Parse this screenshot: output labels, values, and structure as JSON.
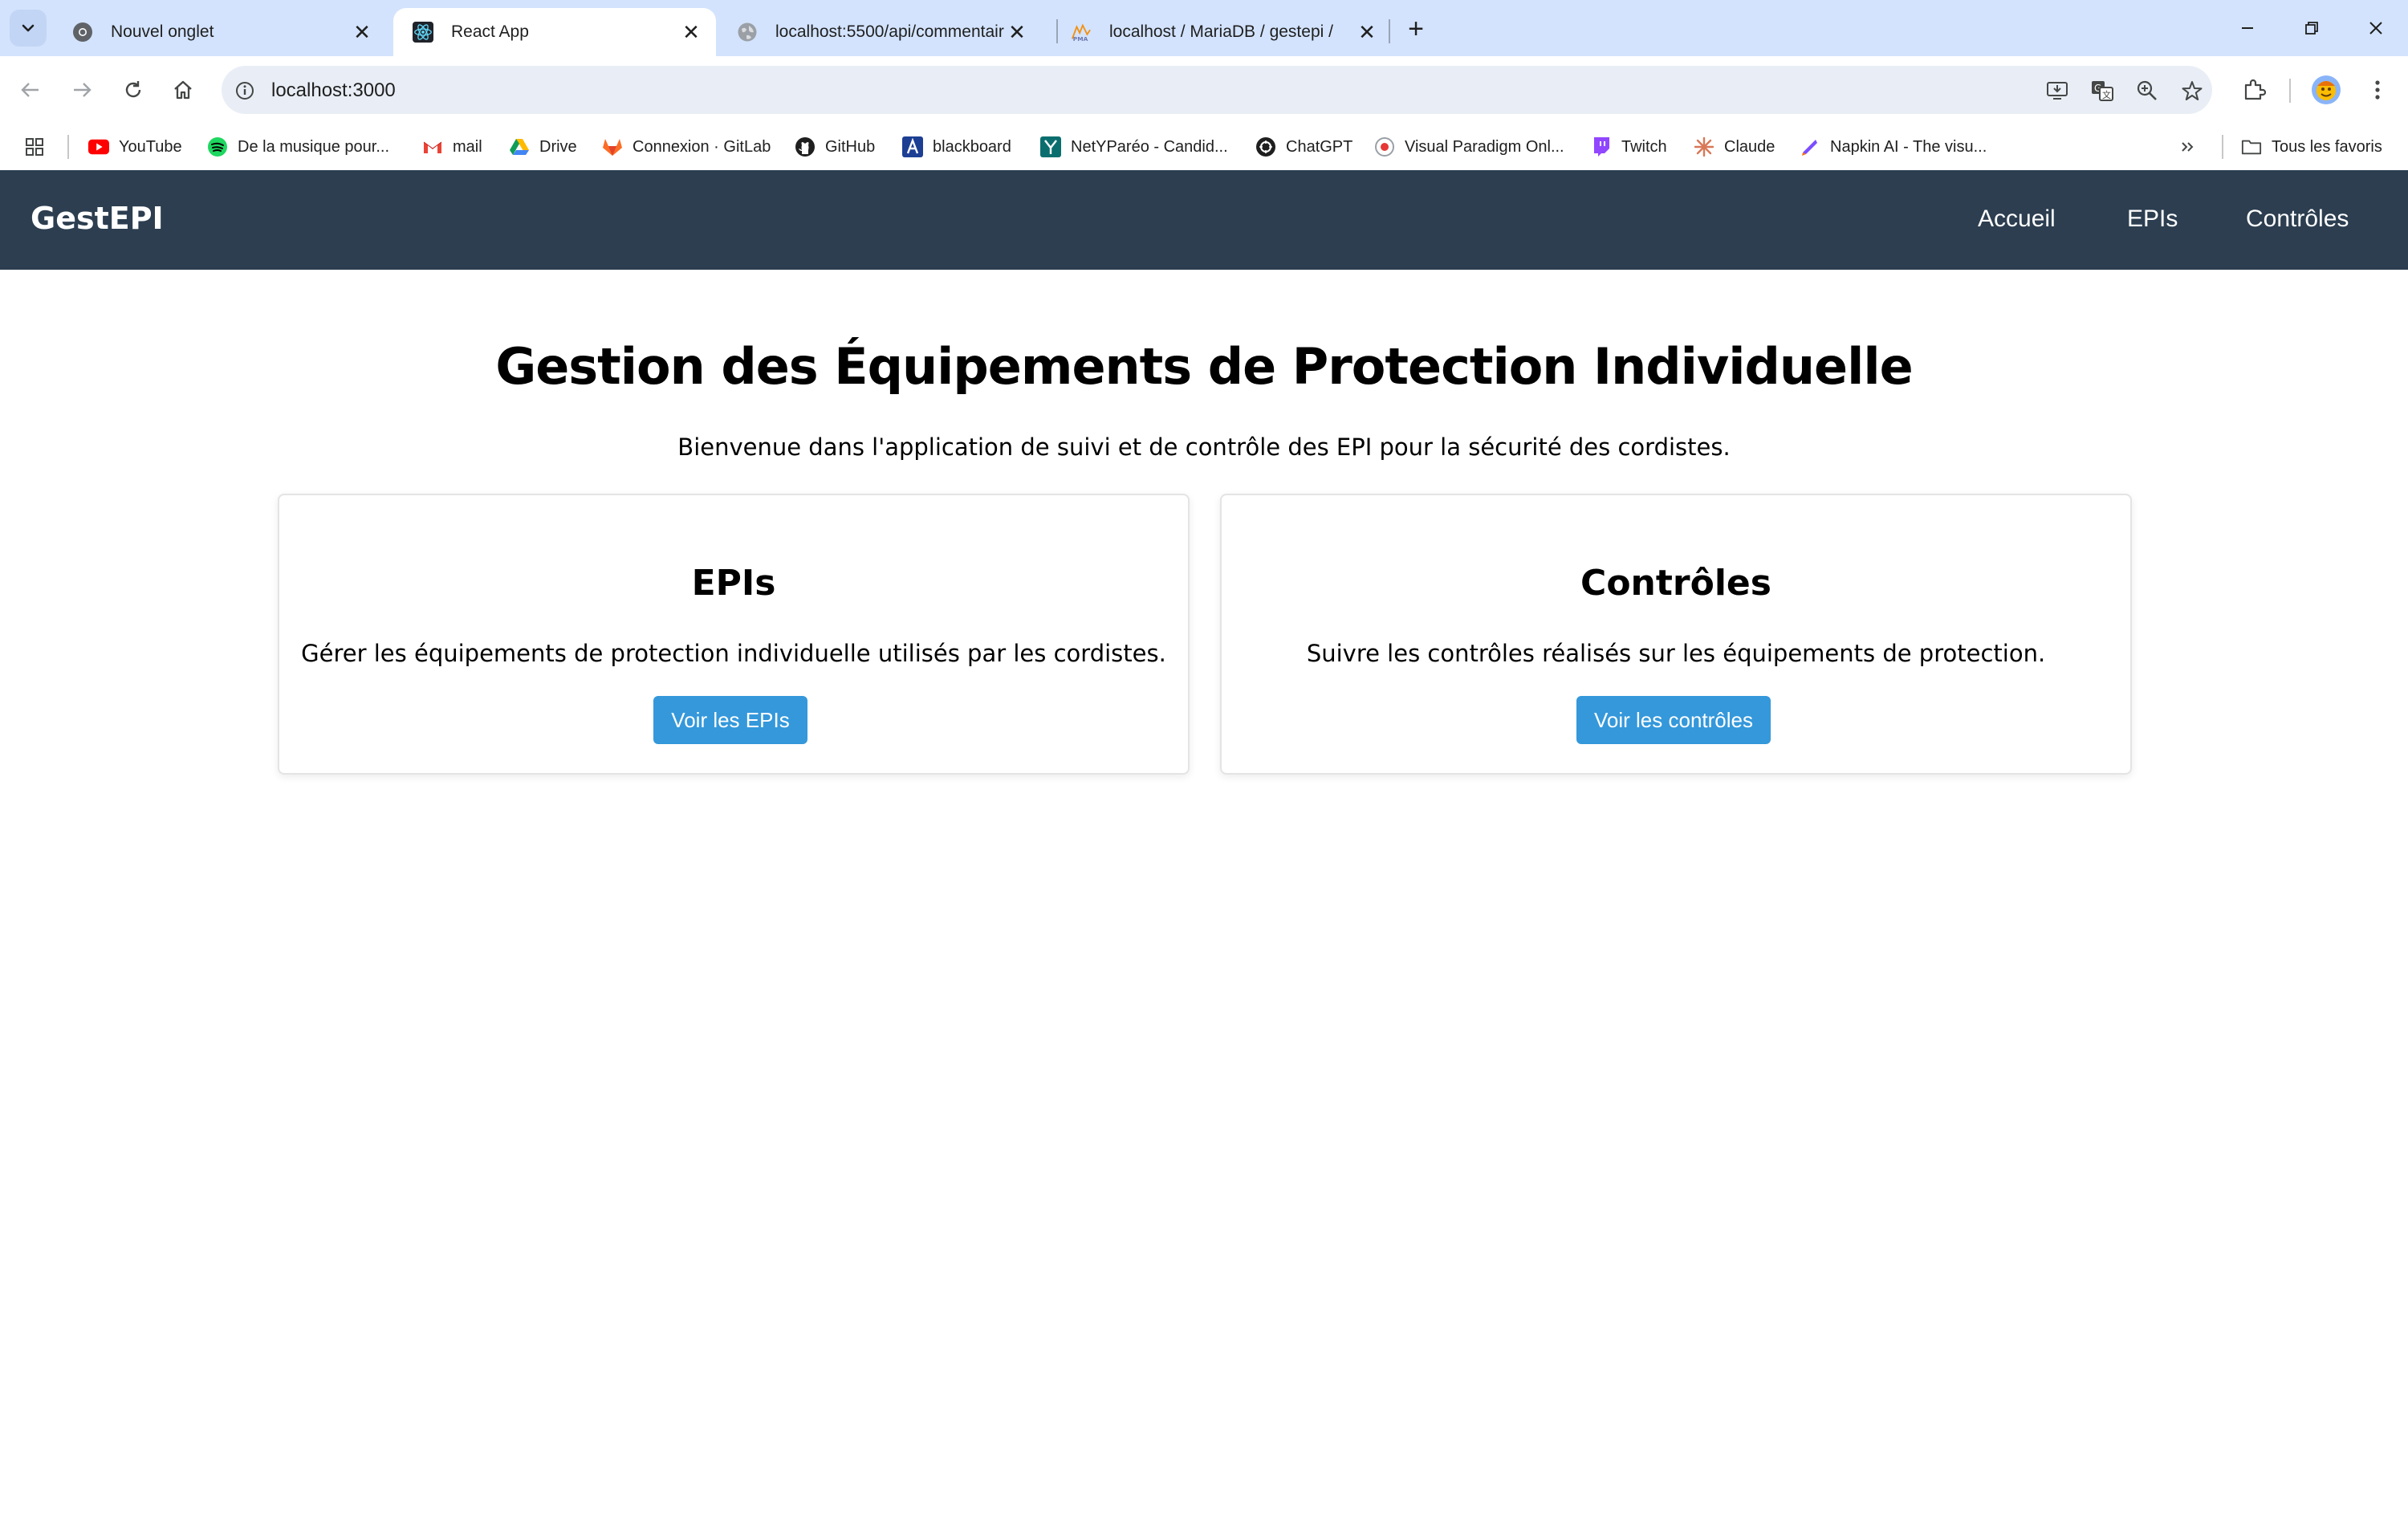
{
  "browser": {
    "tabs": [
      {
        "label": "Nouvel onglet",
        "icon": "chrome-icon",
        "active": false
      },
      {
        "label": "React App",
        "icon": "react-icon",
        "active": true
      },
      {
        "label": "localhost:5500/api/commentair",
        "icon": "globe-icon",
        "active": false
      },
      {
        "label": "localhost / MariaDB / gestepi /",
        "icon": "phpmyadmin-icon",
        "active": false
      }
    ],
    "address": "localhost:3000",
    "bookmarks": [
      {
        "label": "YouTube",
        "icon": "youtube-icon"
      },
      {
        "label": "De la musique pour...",
        "icon": "spotify-icon"
      },
      {
        "label": "mail",
        "icon": "gmail-icon"
      },
      {
        "label": "Drive",
        "icon": "drive-icon"
      },
      {
        "label": "Connexion · GitLab",
        "icon": "gitlab-icon"
      },
      {
        "label": "GitHub",
        "icon": "github-icon"
      },
      {
        "label": "blackboard",
        "icon": "blackboard-icon"
      },
      {
        "label": "NetYParéo - Candid...",
        "icon": "netypareo-icon"
      },
      {
        "label": "ChatGPT",
        "icon": "chatgpt-icon"
      },
      {
        "label": "Visual Paradigm Onl...",
        "icon": "visual-paradigm-icon"
      },
      {
        "label": "Twitch",
        "icon": "twitch-icon"
      },
      {
        "label": "Claude",
        "icon": "claude-icon"
      },
      {
        "label": "Napkin AI - The visu...",
        "icon": "napkin-icon"
      }
    ],
    "all_bookmarks": "Tous les favoris"
  },
  "app": {
    "brand": "GestEPI",
    "nav": {
      "home": "Accueil",
      "epis": "EPIs",
      "controls": "Contrôles"
    },
    "title": "Gestion des Équipements de Protection Individuelle",
    "intro": "Bienvenue dans l'application de suivi et de contrôle des EPI pour la sécurité des cordistes.",
    "cards": [
      {
        "title": "EPIs",
        "text": "Gérer les équipements de protection individuelle utilisés par les cordistes.",
        "button": "Voir les EPIs"
      },
      {
        "title": "Contrôles",
        "text": "Suivre les contrôles réalisés sur les équipements de protection.",
        "button": "Voir les contrôles"
      }
    ]
  },
  "colors": {
    "nav_bg": "#2c3e50",
    "button_bg": "#3498db",
    "tabstrip_bg": "#d3e3fd"
  }
}
